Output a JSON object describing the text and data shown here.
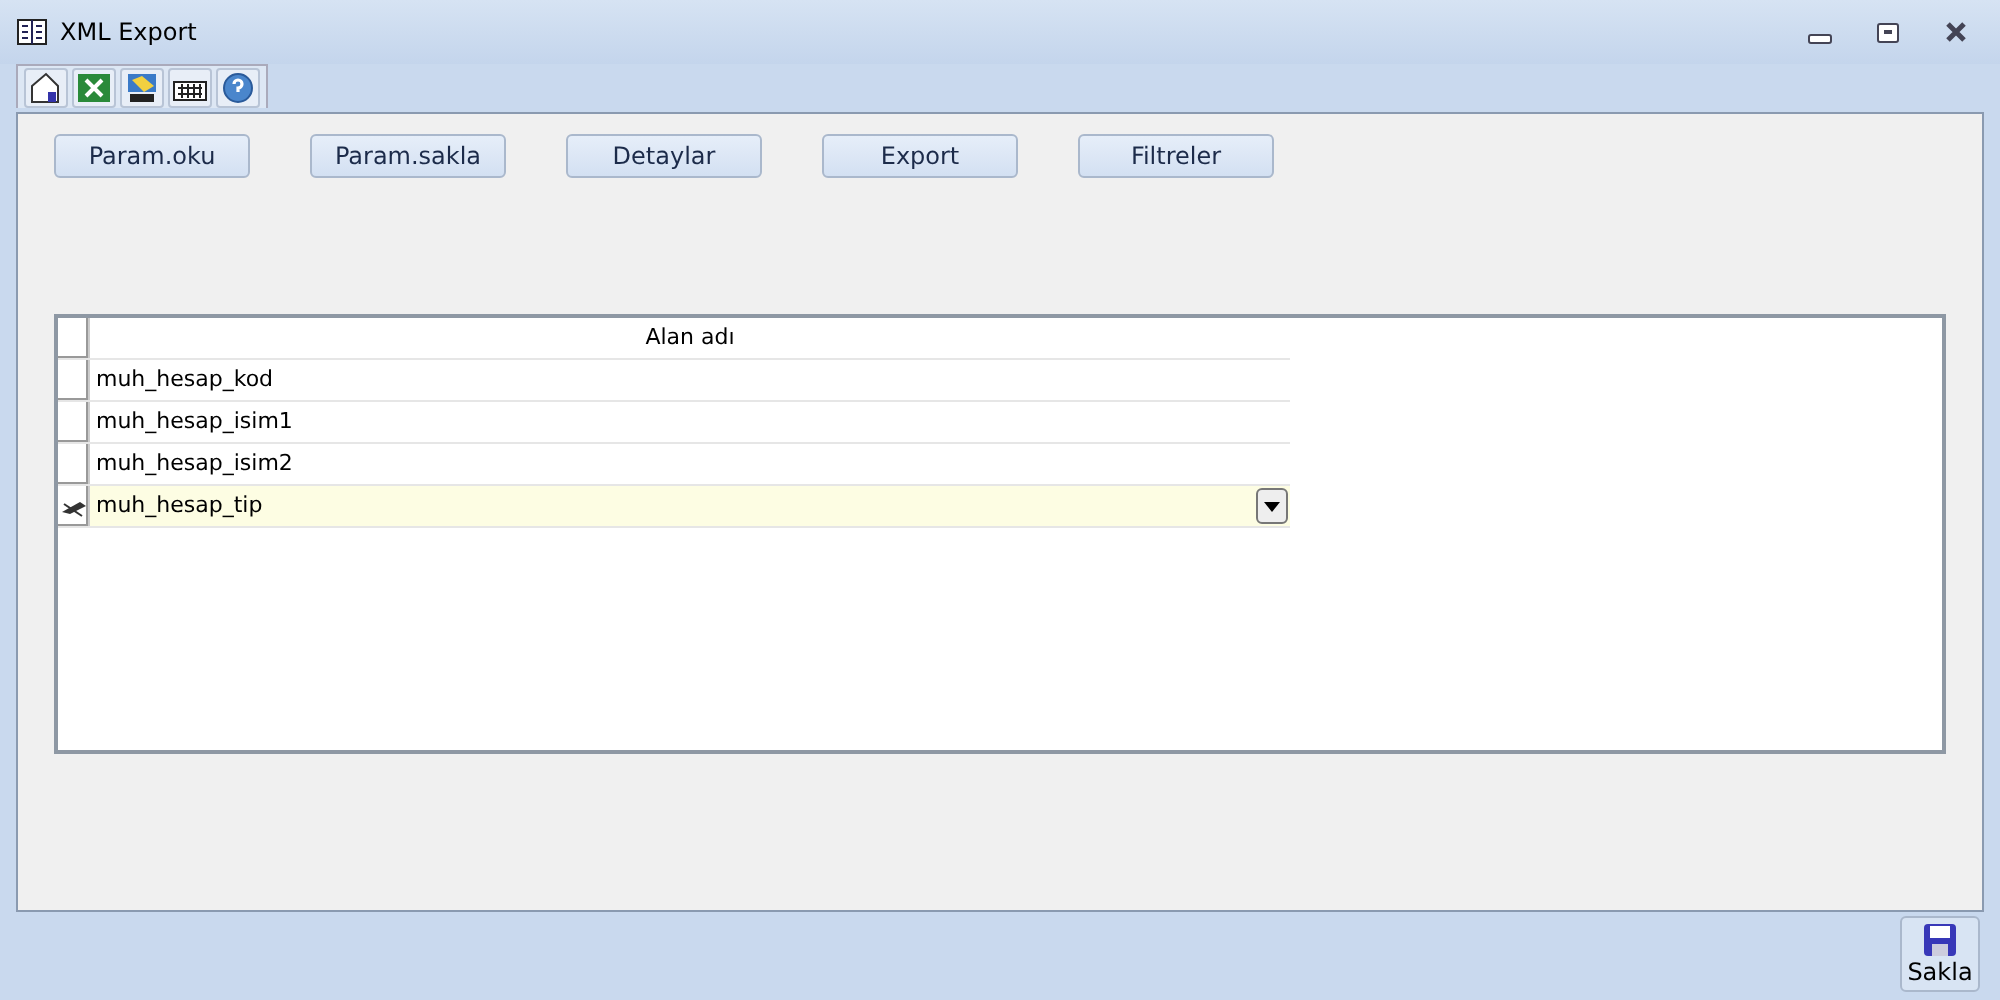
{
  "window": {
    "title": "XML Export"
  },
  "toolbar": {
    "tools": [
      {
        "kind": "home"
      },
      {
        "kind": "excel"
      },
      {
        "kind": "hand"
      },
      {
        "kind": "keyboard"
      },
      {
        "kind": "help"
      }
    ]
  },
  "buttons": [
    "Param.oku",
    "Param.sakla",
    "Detaylar",
    "Export",
    "Filtreler"
  ],
  "grid": {
    "columns": [
      "Alan adı"
    ],
    "rows": [
      {
        "value": "muh_hesap_kod",
        "selected": false
      },
      {
        "value": "muh_hesap_isim1",
        "selected": false
      },
      {
        "value": "muh_hesap_isim2",
        "selected": false
      },
      {
        "value": "muh_hesap_tip",
        "selected": true
      }
    ]
  },
  "footer": {
    "save_button": "Sakla"
  }
}
